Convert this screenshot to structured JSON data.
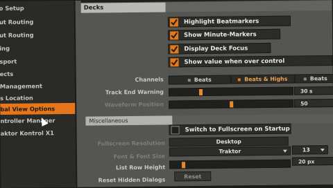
{
  "sidebar": {
    "items": [
      {
        "label": "o Setup"
      },
      {
        "label": "ut Routing"
      },
      {
        "label": "ut Routing"
      },
      {
        "label": "ing"
      },
      {
        "label": "sport"
      },
      {
        "label": "ects"
      },
      {
        "label": "Management"
      },
      {
        "label": "s Location"
      },
      {
        "label": "bal View Options"
      },
      {
        "label": "ntroller Manager"
      },
      {
        "label": "aktor Kontrol X1"
      }
    ]
  },
  "decks": {
    "header": "Decks",
    "checks": [
      {
        "label": "Highlight Beatmarkers",
        "checked": true
      },
      {
        "label": "Show Minute-Markers",
        "checked": true
      },
      {
        "label": "Display Deck Focus",
        "checked": true
      },
      {
        "label": "Show value when over control",
        "checked": true
      }
    ],
    "channels_label": "Channels",
    "channels_options": [
      "Beats",
      "Beats & Highs",
      "Beats"
    ],
    "channels_selected": "Beats & Highs",
    "track_end_label": "Track End Warning",
    "track_end_value": "30 s",
    "track_end_fraction": 0.25,
    "waveform_label": "Waveform Position",
    "waveform_value": "50",
    "waveform_fraction": 0.5
  },
  "misc": {
    "header": "Miscellaneous",
    "fullscreen_label": "Switch to Fullscreen on Startup",
    "fullscreen_checked": false,
    "fullscreen_res_label": "Fullscreen Resolution",
    "resolution_value": "Desktop",
    "font_label": "Font & Font Size",
    "font_value": "Traktor",
    "font_size_value": "13",
    "row_height_label": "List Row Height",
    "row_height_value": "20 px",
    "row_height_fraction": 0.1,
    "reset_label": "Reset Hidden Dialogs",
    "reset_button": "Reset"
  },
  "colors": {
    "accent": "#e57919",
    "panel": "#555652",
    "sidebar": "#2a2b28"
  }
}
